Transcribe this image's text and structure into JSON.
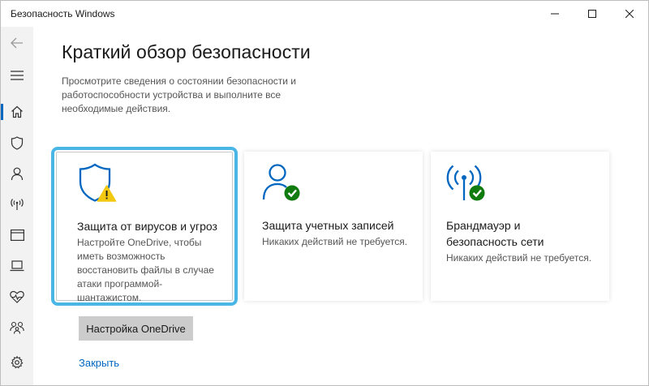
{
  "window": {
    "title": "Безопасность Windows"
  },
  "page": {
    "title": "Краткий обзор безопасности",
    "description": "Просмотрите сведения о состоянии безопасности и работоспособности устройства и выполните все необходимые действия."
  },
  "cards": [
    {
      "title": "Защита от вирусов и угроз",
      "description": "Настройте OneDrive, чтобы иметь возможность восстановить файлы в случае атаки программой-шантажистом.",
      "icon": "shield-warning-icon",
      "status": "warning",
      "action_label": "Настройка OneDrive",
      "dismiss_label": "Закрыть"
    },
    {
      "title": "Защита учетных записей",
      "description": "Никаких действий не требуется.",
      "icon": "person-check-icon",
      "status": "ok"
    },
    {
      "title": "Брандмауэр и безопасность сети",
      "description": "Никаких действий не требуется.",
      "icon": "wireless-check-icon",
      "status": "ok"
    }
  ],
  "sidebar": {
    "items": [
      {
        "icon": "back-arrow-icon"
      },
      {
        "icon": "hamburger-menu-icon"
      },
      {
        "icon": "home-icon",
        "active": true
      },
      {
        "icon": "shield-icon"
      },
      {
        "icon": "person-icon"
      },
      {
        "icon": "wireless-icon"
      },
      {
        "icon": "app-browser-icon"
      },
      {
        "icon": "laptop-icon"
      },
      {
        "icon": "heart-pulse-icon"
      },
      {
        "icon": "family-icon"
      },
      {
        "icon": "gear-icon"
      }
    ]
  },
  "colors": {
    "accent": "#0067c0",
    "focus_ring": "#49b6e6",
    "warning": "#f2c811",
    "ok": "#107c10",
    "sidebar_bg": "#f2f2f2"
  }
}
